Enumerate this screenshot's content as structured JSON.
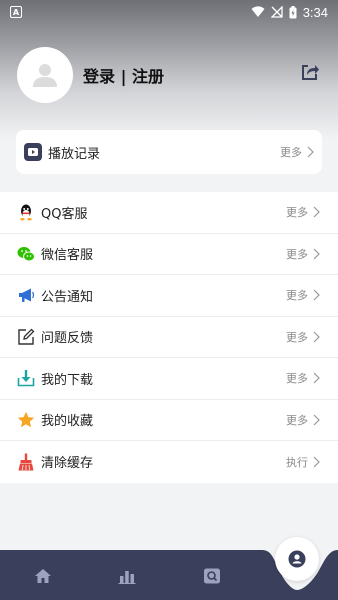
{
  "status_bar": {
    "notif_letter": "A",
    "time": "3:34"
  },
  "profile": {
    "login_label": "登录 | 注册"
  },
  "card": {
    "label": "播放记录",
    "action": "更多"
  },
  "list": [
    {
      "label": "QQ客服",
      "action": "更多",
      "icon": "qq-icon"
    },
    {
      "label": "微信客服",
      "action": "更多",
      "icon": "wechat-icon"
    },
    {
      "label": "公告通知",
      "action": "更多",
      "icon": "megaphone-icon"
    },
    {
      "label": "问题反馈",
      "action": "更多",
      "icon": "edit-icon"
    },
    {
      "label": "我的下载",
      "action": "更多",
      "icon": "download-icon"
    },
    {
      "label": "我的收藏",
      "action": "更多",
      "icon": "star-icon"
    },
    {
      "label": "清除缓存",
      "action": "执行",
      "icon": "broom-icon"
    }
  ],
  "colors": {
    "nav_bg": "#3a3f5c",
    "accent_blue": "#2f6fd6",
    "star": "#f5a623",
    "broom": "#e6483e"
  }
}
